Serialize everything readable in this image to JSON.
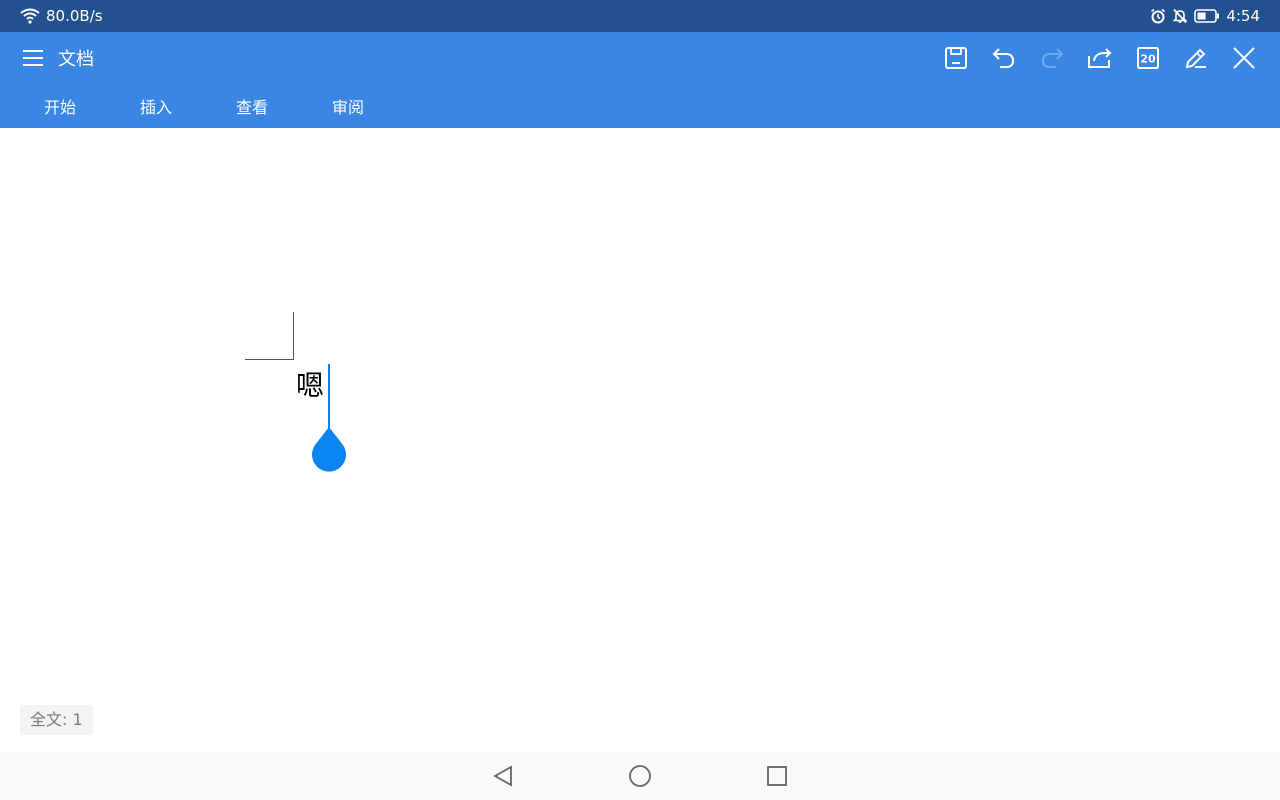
{
  "status_bar": {
    "network_speed": "80.0B/s",
    "time": "4:54",
    "icons": [
      "wifi-icon",
      "alarm-icon",
      "mute-icon",
      "battery-icon"
    ]
  },
  "toolbar": {
    "title": "文档",
    "page_badge": "20",
    "icons": [
      "menu-icon",
      "save-icon",
      "undo-icon",
      "redo-icon",
      "share-icon",
      "page-count-icon",
      "edit-icon",
      "close-icon"
    ],
    "redo_disabled": true
  },
  "tabs": [
    "开始",
    "插入",
    "查看",
    "审阅"
  ],
  "document": {
    "text": "嗯"
  },
  "footer": {
    "word_count": "全文: 1"
  },
  "navigation": {
    "icons": [
      "back-icon",
      "home-icon",
      "recents-icon"
    ]
  },
  "colors": {
    "status_bar_bg": "#23518f",
    "toolbar_bg": "#3a86e4",
    "cursor": "#1a7fe0"
  }
}
